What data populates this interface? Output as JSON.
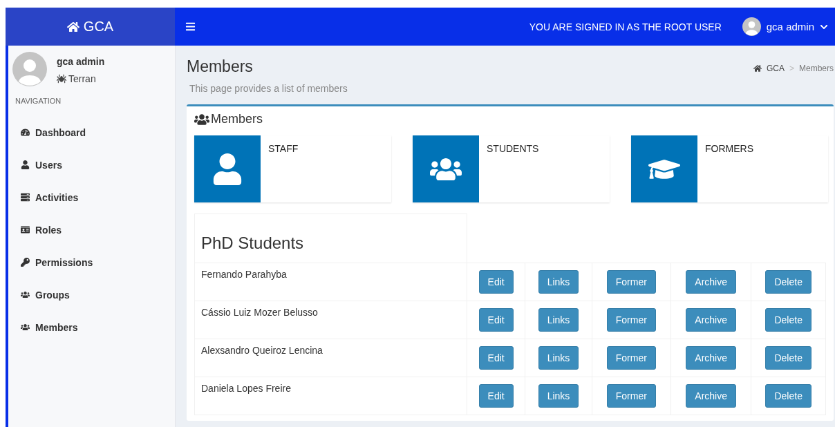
{
  "topbar": {
    "brand": "GCA",
    "notice": "YOU ARE SIGNED IN AS THE ROOT USER",
    "user": "gca admin"
  },
  "sidebar": {
    "user": {
      "name": "gca admin",
      "role": "Terran"
    },
    "heading": "NAVIGATION",
    "items": [
      {
        "label": "Dashboard"
      },
      {
        "label": "Users"
      },
      {
        "label": "Activities"
      },
      {
        "label": "Roles"
      },
      {
        "label": "Permissions"
      },
      {
        "label": "Groups"
      },
      {
        "label": "Members"
      }
    ]
  },
  "page": {
    "title": "Members",
    "subtitle": "This page provides a list of members",
    "breadcrumb": [
      "GCA",
      "Members"
    ],
    "separator": ">"
  },
  "panel": {
    "title": "Members",
    "tiles": [
      {
        "label": "STAFF"
      },
      {
        "label": "STUDENTS"
      },
      {
        "label": "FORMERS"
      }
    ],
    "table": {
      "title": "PhD Students",
      "rows": [
        {
          "name": "Fernando Parahyba",
          "actions": [
            "Edit",
            "Links",
            "Former",
            "Archive",
            "Delete"
          ]
        },
        {
          "name": "Cássio Luiz Mozer Belusso",
          "actions": [
            "Edit",
            "Links",
            "Former",
            "Archive",
            "Delete"
          ]
        },
        {
          "name": "Alexsandro Queiroz Lencina",
          "actions": [
            "Edit",
            "Links",
            "Former",
            "Archive",
            "Delete"
          ]
        },
        {
          "name": "Daniela Lopes Freire",
          "actions": [
            "Edit",
            "Links",
            "Former",
            "Archive",
            "Delete"
          ]
        }
      ]
    }
  }
}
